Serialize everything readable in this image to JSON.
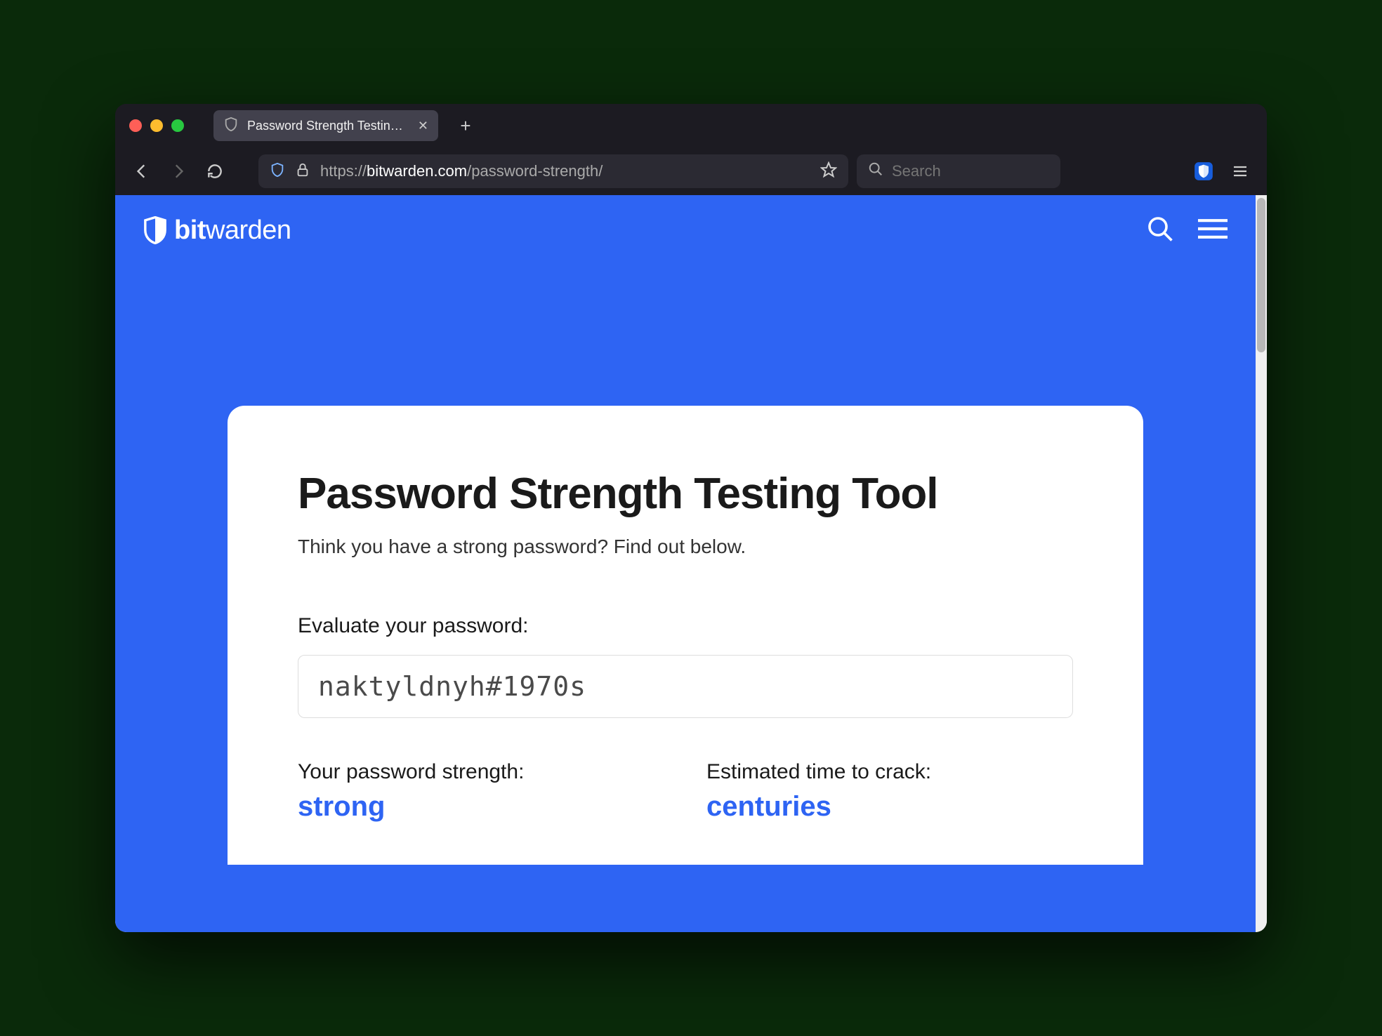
{
  "browser": {
    "tab_title": "Password Strength Testing Tool",
    "url_protocol": "https://",
    "url_domain": "bitwarden.com",
    "url_path": "/password-strength/",
    "search_placeholder": "Search"
  },
  "header": {
    "brand_bold": "bit",
    "brand_rest": "warden"
  },
  "main": {
    "title": "Password Strength Testing Tool",
    "subtitle": "Think you have a strong password? Find out below.",
    "evaluate_label": "Evaluate your password:",
    "password_value": "naktyldnyh#1970s",
    "strength_label": "Your password strength:",
    "strength_value": "strong",
    "crack_label": "Estimated time to crack:",
    "crack_value": "centuries"
  }
}
